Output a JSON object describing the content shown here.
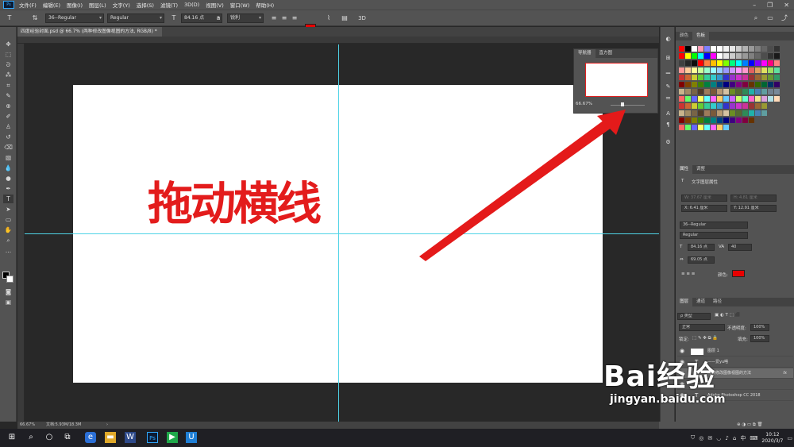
{
  "app": {
    "name": "Ps"
  },
  "menu": [
    "文件(F)",
    "编辑(E)",
    "图像(I)",
    "图层(L)",
    "文字(Y)",
    "选择(S)",
    "滤镜(T)",
    "3D(D)",
    "视图(V)",
    "窗口(W)",
    "帮助(H)"
  ],
  "options": {
    "font_family": "36--Regular",
    "font_style": "Regular",
    "font_size": "84.16 点",
    "aa": "锐利",
    "color": "#e80000",
    "threed": "3D"
  },
  "document": {
    "tab": "四度经验封面.psd @ 66.7% (两种修改图像视图的方法, RGB/8) *",
    "text": "拖动横线",
    "text_color": "#e31c1c"
  },
  "navigator": {
    "tabs": [
      "导航器",
      "直方图"
    ],
    "zoom": "66.67%"
  },
  "right_panels": {
    "top_tabs": [
      "颜色",
      "色板"
    ],
    "props_tabs": [
      "属性",
      "调整"
    ],
    "props_title": "文字图层属性",
    "props_w": "W: 37.67 厘米",
    "props_h": "H: 4.81 厘米",
    "props_x": "X: 6.41 厘米",
    "props_y": "Y: 12.91 厘米",
    "font": "36--Regular",
    "style": "Regular",
    "size": "84.16 点",
    "leading": "40",
    "tracking": "69.05 点",
    "color_label": "颜色:",
    "layers_tabs": [
      "图层",
      "通道",
      "路径"
    ],
    "filter": "ρ 类型",
    "blend": "正常",
    "opacity_label": "不透明度:",
    "opacity": "100%",
    "lock_label": "锁定:",
    "fill_label": "填充:",
    "fill": "100%",
    "layers": [
      {
        "name": "图层 1",
        "type": "pixel"
      },
      {
        "name": "——爱yu嗒",
        "type": "text"
      },
      {
        "name": "两种修改图像视图的方法",
        "type": "text",
        "fx": "fx"
      },
      {
        "name": "",
        "type": "text"
      },
      {
        "name": "Adobe Photoshop CC 2018",
        "type": "text"
      }
    ]
  },
  "status": {
    "zoom": "66.67%",
    "doc": "文档:5.93M/18.3M"
  },
  "taskbar": {
    "time": "10:12",
    "date": "2020/3/7",
    "ime": "中"
  },
  "watermark": {
    "brand": "Bai经验",
    "url": "jingyan.baidu.com"
  }
}
